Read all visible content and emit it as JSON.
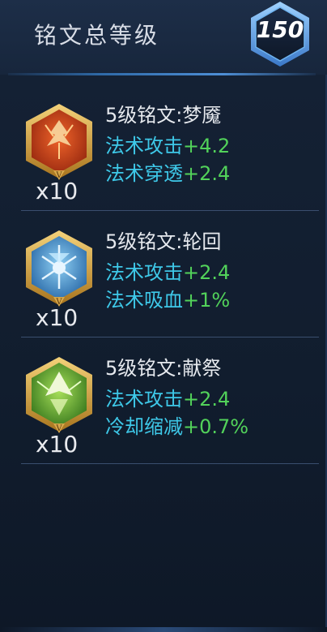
{
  "header": {
    "title": "铭文总等级",
    "level": "150"
  },
  "runes": [
    {
      "name": "5级铭文:梦魇",
      "count": "x10",
      "icon": "red-rune-icon",
      "color": "#c84a1e",
      "stats": [
        {
          "label": "法术攻击",
          "value": "+4.2"
        },
        {
          "label": "法术穿透",
          "value": "+2.4"
        }
      ]
    },
    {
      "name": "5级铭文:轮回",
      "count": "x10",
      "icon": "blue-rune-icon",
      "color": "#3e8fd0",
      "stats": [
        {
          "label": "法术攻击",
          "value": "+2.4"
        },
        {
          "label": "法术吸血",
          "value": "+1%"
        }
      ]
    },
    {
      "name": "5级铭文:献祭",
      "count": "x10",
      "icon": "green-rune-icon",
      "color": "#5aa83a",
      "stats": [
        {
          "label": "法术攻击",
          "value": "+2.4"
        },
        {
          "label": "冷却缩减",
          "value": "+0.7%"
        }
      ]
    }
  ]
}
